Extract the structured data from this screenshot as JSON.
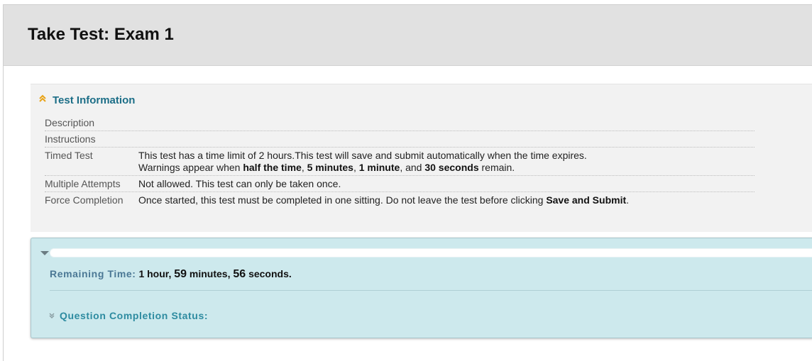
{
  "page": {
    "title": "Take Test: Exam 1"
  },
  "test_info": {
    "heading": "Test Information",
    "rows": [
      {
        "label": "Description",
        "value": ""
      },
      {
        "label": "Instructions",
        "value": ""
      },
      {
        "label": "Timed Test",
        "line1": "This test has a time limit of 2 hours.This test will save and submit automatically when the time expires.",
        "line2_prefix": "Warnings appear when ",
        "warn_1": "half the time",
        "sep_1": ", ",
        "warn_2": "5 minutes",
        "sep_2": ", ",
        "warn_3": "1 minute",
        "sep_3": ", and ",
        "warn_4": "30 seconds",
        "line2_suffix": " remain."
      },
      {
        "label": "Multiple Attempts",
        "value": "Not allowed. This test can only be taken once."
      },
      {
        "label": "Force Completion",
        "value": "Once started, this test must be completed in one sitting. Do not leave the test before clicking ",
        "emphasis": "Save and Submit",
        "suffix": "."
      }
    ]
  },
  "timer": {
    "remaining_label": "Remaining Time:",
    "hour_num": "1",
    "hour_unit": " hour, ",
    "minutes_num": "59",
    "minutes_unit": " minutes, ",
    "seconds_num": "56",
    "seconds_unit": " seconds.",
    "elapsed_fraction": 0.0
  },
  "question_status": {
    "label": "Question Completion Status:"
  },
  "colors": {
    "accent_title": "#1c6e87",
    "timer_bg": "#cde9ed",
    "status_link": "#2d8ba0",
    "chevron": "#e8a317"
  }
}
